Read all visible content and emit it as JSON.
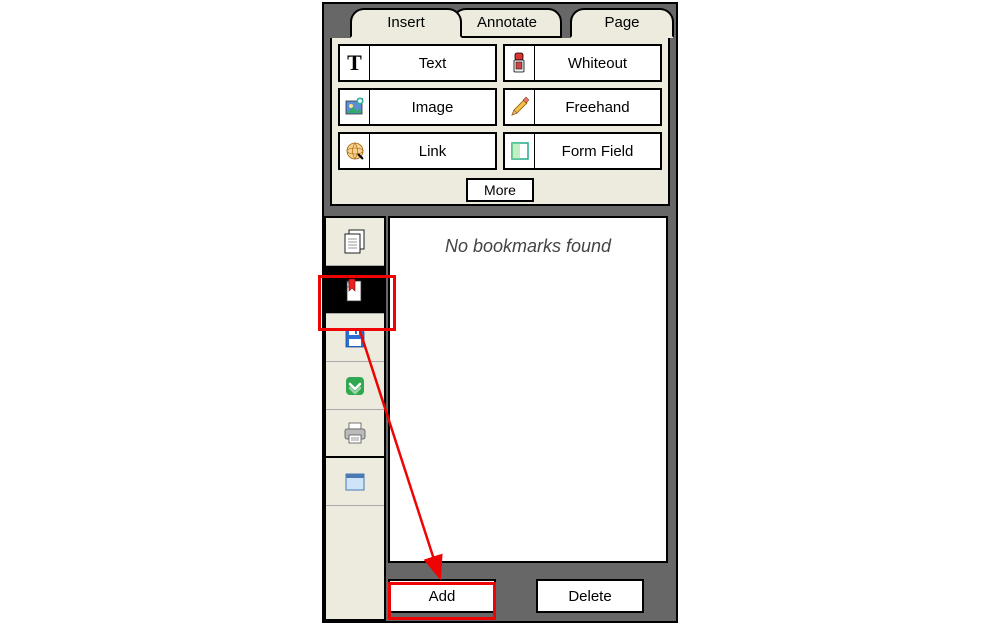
{
  "tabs": {
    "insert": "Insert",
    "annotate": "Annotate",
    "page": "Page"
  },
  "tools": {
    "text": "Text",
    "whiteout": "Whiteout",
    "image": "Image",
    "freehand": "Freehand",
    "link": "Link",
    "formfield": "Form Field",
    "more": "More"
  },
  "panel": {
    "empty_message": "No bookmarks found"
  },
  "actions": {
    "add": "Add",
    "delete": "Delete"
  },
  "highlight_color": "#ef0404"
}
